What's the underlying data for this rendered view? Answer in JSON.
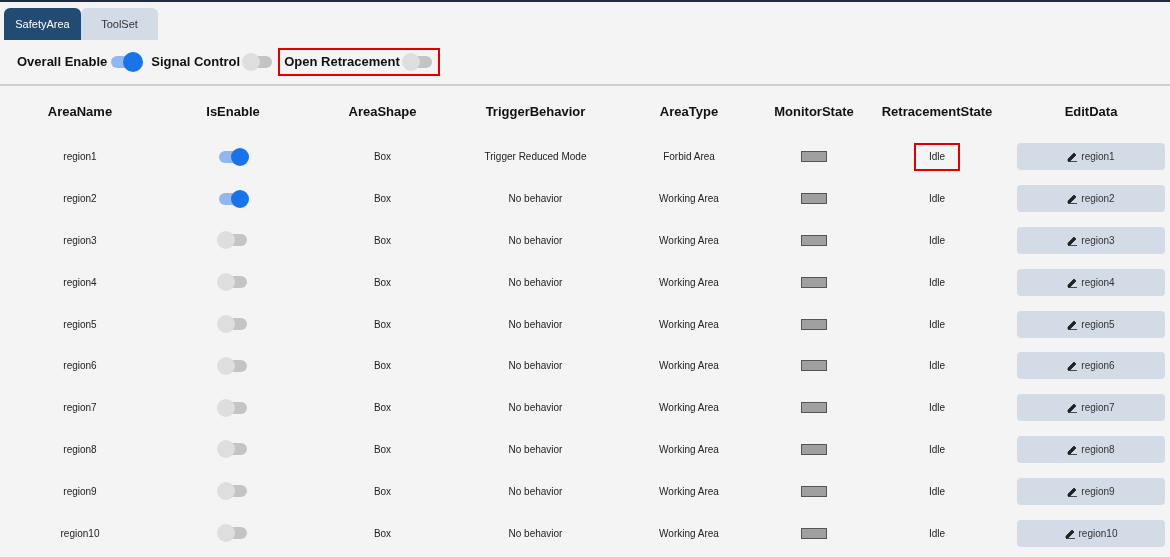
{
  "tabs": [
    {
      "label": "SafetyArea",
      "selected": true
    },
    {
      "label": "ToolSet",
      "selected": false
    }
  ],
  "switches": [
    {
      "label": "Overall Enable",
      "on": true,
      "highlighted": false
    },
    {
      "label": "Signal Control",
      "on": false,
      "highlighted": false
    },
    {
      "label": "Open Retracement",
      "on": false,
      "highlighted": true
    }
  ],
  "table": {
    "columns": [
      "AreaName",
      "IsEnable",
      "AreaShape",
      "TriggerBehavior",
      "AreaType",
      "MonitorState",
      "RetracementState",
      "EditData"
    ],
    "rows": [
      {
        "name": "region1",
        "enabled": true,
        "shape": "Box",
        "trigger": "Trigger Reduced Mode",
        "type": "Forbid Area",
        "retracement": "Idle",
        "retracement_highlighted": true,
        "edit": "region1"
      },
      {
        "name": "region2",
        "enabled": true,
        "shape": "Box",
        "trigger": "No behavior",
        "type": "Working Area",
        "retracement": "Idle",
        "retracement_highlighted": false,
        "edit": "region2"
      },
      {
        "name": "region3",
        "enabled": false,
        "shape": "Box",
        "trigger": "No behavior",
        "type": "Working Area",
        "retracement": "Idle",
        "retracement_highlighted": false,
        "edit": "region3"
      },
      {
        "name": "region4",
        "enabled": false,
        "shape": "Box",
        "trigger": "No behavior",
        "type": "Working Area",
        "retracement": "Idle",
        "retracement_highlighted": false,
        "edit": "region4"
      },
      {
        "name": "region5",
        "enabled": false,
        "shape": "Box",
        "trigger": "No behavior",
        "type": "Working Area",
        "retracement": "Idle",
        "retracement_highlighted": false,
        "edit": "region5"
      },
      {
        "name": "region6",
        "enabled": false,
        "shape": "Box",
        "trigger": "No behavior",
        "type": "Working Area",
        "retracement": "Idle",
        "retracement_highlighted": false,
        "edit": "region6"
      },
      {
        "name": "region7",
        "enabled": false,
        "shape": "Box",
        "trigger": "No behavior",
        "type": "Working Area",
        "retracement": "Idle",
        "retracement_highlighted": false,
        "edit": "region7"
      },
      {
        "name": "region8",
        "enabled": false,
        "shape": "Box",
        "trigger": "No behavior",
        "type": "Working Area",
        "retracement": "Idle",
        "retracement_highlighted": false,
        "edit": "region8"
      },
      {
        "name": "region9",
        "enabled": false,
        "shape": "Box",
        "trigger": "No behavior",
        "type": "Working Area",
        "retracement": "Idle",
        "retracement_highlighted": false,
        "edit": "region9"
      },
      {
        "name": "region10",
        "enabled": false,
        "shape": "Box",
        "trigger": "No behavior",
        "type": "Working Area",
        "retracement": "Idle",
        "retracement_highlighted": false,
        "edit": "region10"
      }
    ]
  }
}
